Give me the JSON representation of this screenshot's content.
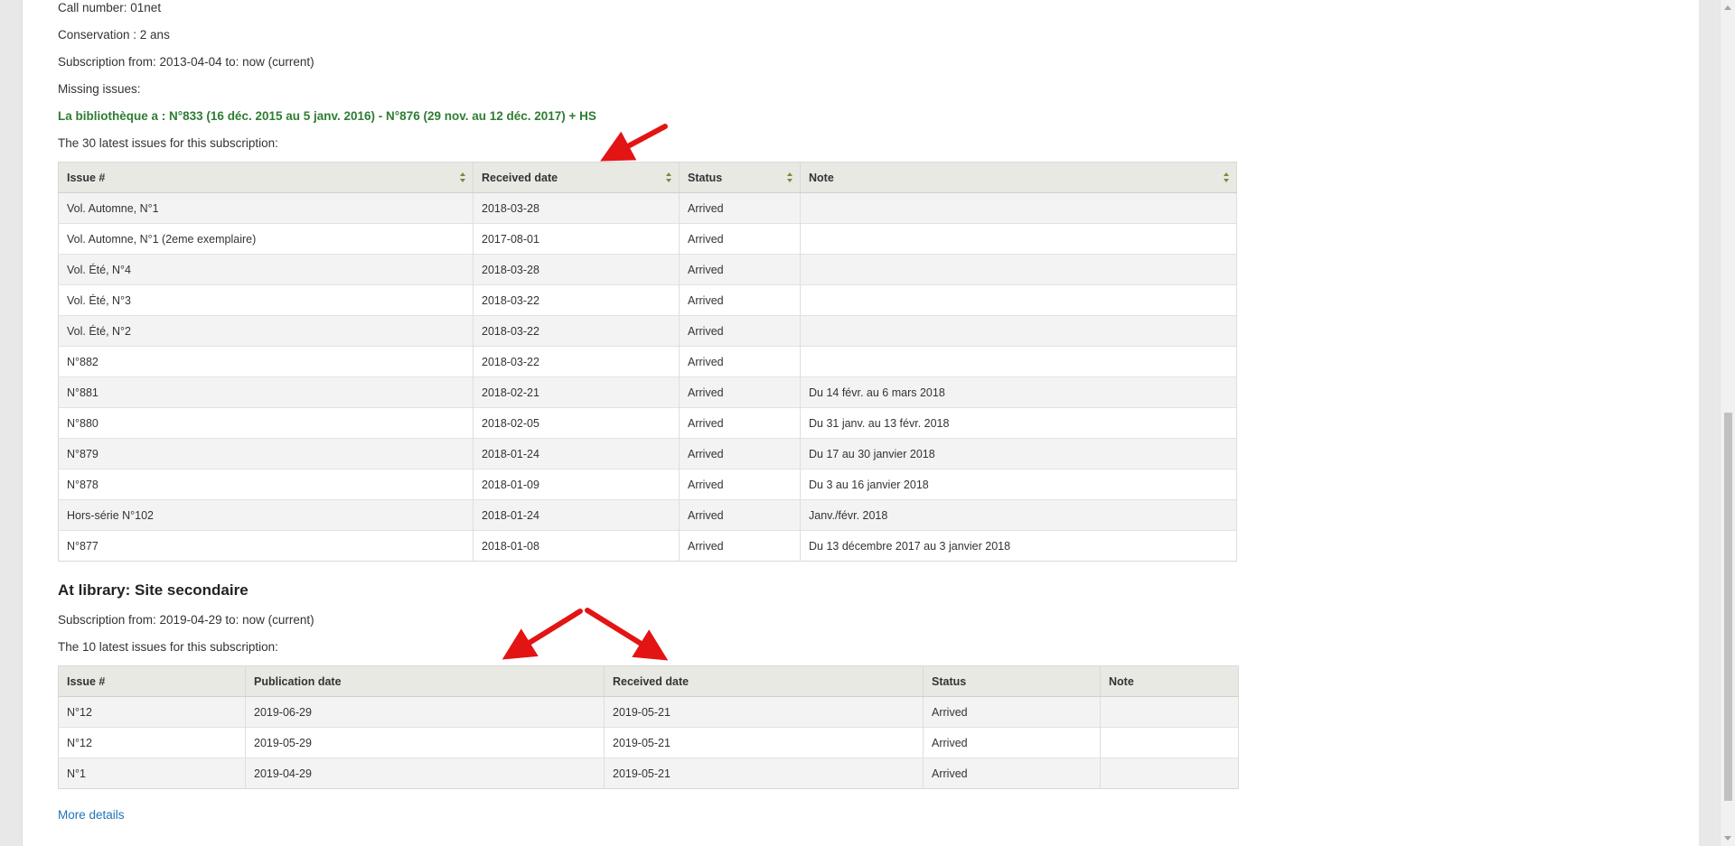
{
  "subscription1": {
    "call_number": "Call number: 01net",
    "conservation": "Conservation : 2 ans",
    "subscription_from": "Subscription from: 2013-04-04 to: now (current)",
    "missing_label": "Missing issues:",
    "missing_detail": "La bibliothèque a : N°833 (16 déc. 2015 au 5 janv. 2016) - N°876 (29 nov. au 12 déc. 2017) + HS",
    "latest_label": "The 30 latest issues for this subscription:",
    "columns": [
      "Issue #",
      "Received date",
      "Status",
      "Note"
    ],
    "rows": [
      {
        "issue": "Vol. Automne, N°1",
        "received": "2018-03-28",
        "status": "Arrived",
        "note": ""
      },
      {
        "issue": "Vol. Automne, N°1 (2eme exemplaire)",
        "received": "2017-08-01",
        "status": "Arrived",
        "note": ""
      },
      {
        "issue": "Vol. Été, N°4",
        "received": "2018-03-28",
        "status": "Arrived",
        "note": ""
      },
      {
        "issue": "Vol. Été, N°3",
        "received": "2018-03-22",
        "status": "Arrived",
        "note": ""
      },
      {
        "issue": "Vol. Été, N°2",
        "received": "2018-03-22",
        "status": "Arrived",
        "note": ""
      },
      {
        "issue": "N°882",
        "received": "2018-03-22",
        "status": "Arrived",
        "note": ""
      },
      {
        "issue": "N°881",
        "received": "2018-02-21",
        "status": "Arrived",
        "note": "Du 14 févr. au 6 mars 2018"
      },
      {
        "issue": "N°880",
        "received": "2018-02-05",
        "status": "Arrived",
        "note": "Du 31 janv. au 13 févr. 2018"
      },
      {
        "issue": "N°879",
        "received": "2018-01-24",
        "status": "Arrived",
        "note": "Du 17 au 30 janvier 2018"
      },
      {
        "issue": "N°878",
        "received": "2018-01-09",
        "status": "Arrived",
        "note": "Du 3 au 16 janvier 2018"
      },
      {
        "issue": "Hors-série N°102",
        "received": "2018-01-24",
        "status": "Arrived",
        "note": "Janv./févr. 2018"
      },
      {
        "issue": "N°877",
        "received": "2018-01-08",
        "status": "Arrived",
        "note": "Du 13 décembre 2017 au 3 janvier 2018"
      }
    ]
  },
  "subscription2": {
    "library_heading": "At library: Site secondaire",
    "subscription_from": "Subscription from: 2019-04-29 to: now (current)",
    "latest_label": "The 10 latest issues for this subscription:",
    "columns": [
      "Issue #",
      "Publication date",
      "Received date",
      "Status",
      "Note"
    ],
    "rows": [
      {
        "issue": "N°12",
        "published": "2019-06-29",
        "received": "2019-05-21",
        "status": "Arrived",
        "note": ""
      },
      {
        "issue": "N°12",
        "published": "2019-05-29",
        "received": "2019-05-21",
        "status": "Arrived",
        "note": ""
      },
      {
        "issue": "N°1",
        "published": "2019-04-29",
        "received": "2019-05-21",
        "status": "Arrived",
        "note": ""
      }
    ]
  },
  "more_details": "More details",
  "colors": {
    "missing_text": "#2e7d32",
    "link": "#1f73b7",
    "annotation_arrow": "#e31414",
    "table_header_bg": "#e9e9e3"
  }
}
